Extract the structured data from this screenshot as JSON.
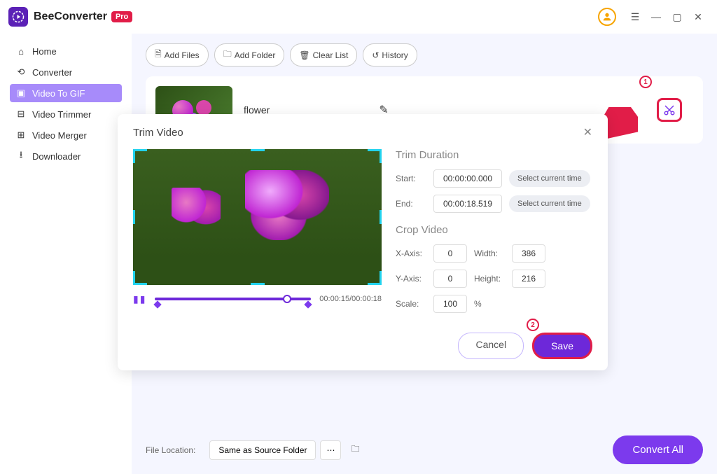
{
  "app": {
    "name": "BeeConverter",
    "badge": "Pro"
  },
  "nav": {
    "home": "Home",
    "converter": "Converter",
    "videoToGif": "Video To GIF",
    "videoTrimmer": "Video Trimmer",
    "videoMerger": "Video Merger",
    "downloader": "Downloader"
  },
  "toolbar": {
    "addFiles": "Add Files",
    "addFolder": "Add Folder",
    "clearList": "Clear List",
    "history": "History"
  },
  "file": {
    "name": "flower"
  },
  "modal": {
    "title": "Trim Video",
    "trimDuration": "Trim Duration",
    "startLabel": "Start:",
    "startValue": "00:00:00.000",
    "endLabel": "End:",
    "endValue": "00:00:18.519",
    "selectCurrent": "Select current time",
    "cropVideo": "Crop Video",
    "xAxisLabel": "X-Axis:",
    "xAxisValue": "0",
    "widthLabel": "Width:",
    "widthValue": "386",
    "yAxisLabel": "Y-Axis:",
    "yAxisValue": "0",
    "heightLabel": "Height:",
    "heightValue": "216",
    "scaleLabel": "Scale:",
    "scaleValue": "100",
    "pct": "%",
    "currentTime": "00:00:15",
    "totalTime": "00:00:18",
    "cancel": "Cancel",
    "save": "Save"
  },
  "annotations": {
    "step1": "1",
    "step2": "2"
  },
  "footer": {
    "locLabel": "File Location:",
    "locValue": "Same as Source Folder",
    "convertAll": "Convert All"
  }
}
